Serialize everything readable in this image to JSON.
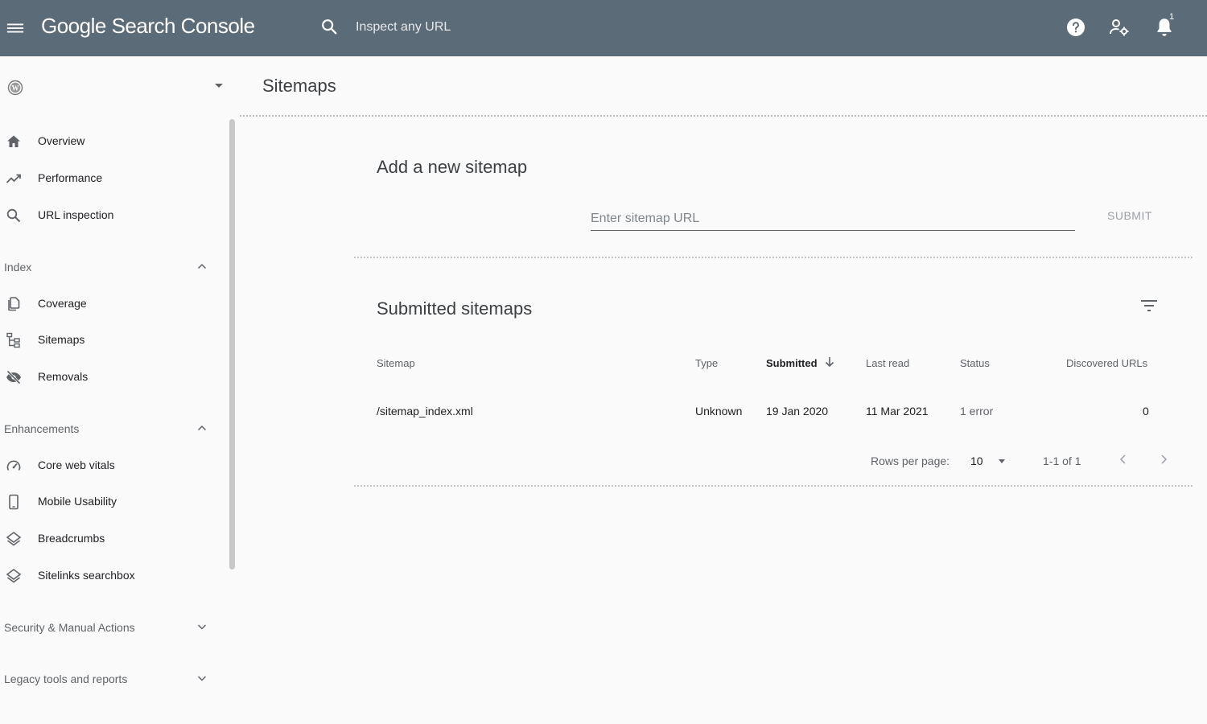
{
  "header": {
    "brand": "Google Search Console",
    "search_placeholder": "Inspect any URL",
    "notification_count": "1",
    "color": "#5b6b78"
  },
  "sidebar": {
    "property_icon": "wordpress-icon",
    "top_items": [
      {
        "label": "Overview",
        "icon": "home-icon"
      },
      {
        "label": "Performance",
        "icon": "trending-up-icon"
      },
      {
        "label": "URL inspection",
        "icon": "search-icon"
      }
    ],
    "sections": [
      {
        "label": "Index",
        "expanded": true,
        "items": [
          {
            "label": "Coverage",
            "icon": "copy-icon"
          },
          {
            "label": "Sitemaps",
            "icon": "sitemap-icon"
          },
          {
            "label": "Removals",
            "icon": "visibility-off-icon"
          }
        ]
      },
      {
        "label": "Enhancements",
        "expanded": true,
        "items": [
          {
            "label": "Core web vitals",
            "icon": "speed-gauge-icon"
          },
          {
            "label": "Mobile Usability",
            "icon": "smartphone-icon"
          },
          {
            "label": "Breadcrumbs",
            "icon": "layers-icon"
          },
          {
            "label": "Sitelinks searchbox",
            "icon": "layers-icon"
          }
        ]
      },
      {
        "label": "Security & Manual Actions",
        "expanded": false,
        "items": []
      },
      {
        "label": "Legacy tools and reports",
        "expanded": false,
        "items": []
      }
    ]
  },
  "main": {
    "title": "Sitemaps",
    "add": {
      "title": "Add a new sitemap",
      "input_placeholder": "Enter sitemap URL",
      "input_value": "",
      "submit_label": "SUBMIT"
    },
    "submitted": {
      "title": "Submitted sitemaps",
      "columns": [
        "Sitemap",
        "Type",
        "Submitted",
        "Last read",
        "Status",
        "Discovered URLs"
      ],
      "sorted_column": "Submitted",
      "rows": [
        {
          "sitemap": "/sitemap_index.xml",
          "type": "Unknown",
          "submitted": "19 Jan 2020",
          "last_read": "11 Mar 2021",
          "status": "1 error",
          "discovered": "0"
        }
      ],
      "pagination": {
        "rows_per_page_label": "Rows per page:",
        "rows_per_page": "10",
        "range": "1-1 of 1"
      }
    }
  }
}
